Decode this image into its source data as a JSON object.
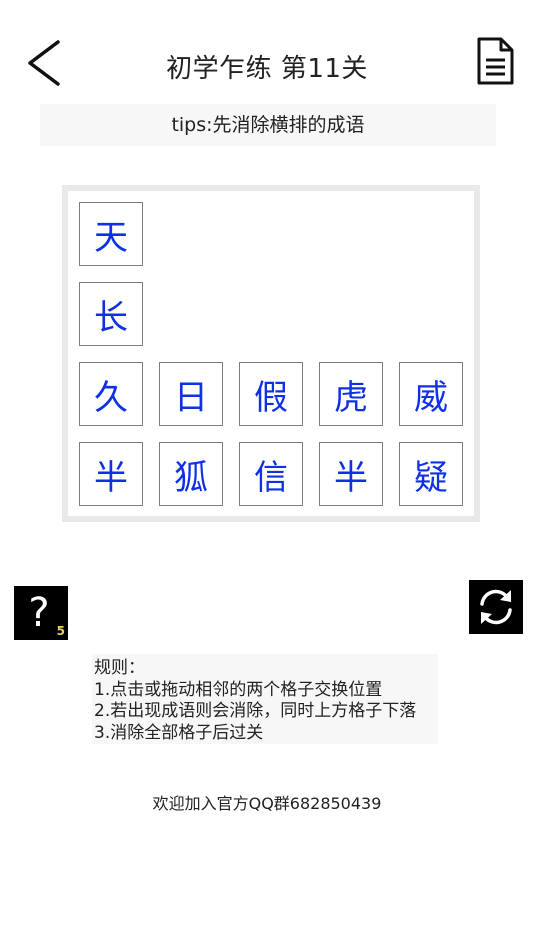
{
  "header": {
    "back_icon": "chevron-left-icon",
    "title": "初学乍练 第11关",
    "doc_icon": "document-icon"
  },
  "tips": "tips:先消除横排的成语",
  "board": {
    "cells": [
      {
        "char": "天",
        "row": 1,
        "col": 1
      },
      {
        "char": "长",
        "row": 2,
        "col": 1
      },
      {
        "char": "久",
        "row": 3,
        "col": 1
      },
      {
        "char": "日",
        "row": 3,
        "col": 2
      },
      {
        "char": "假",
        "row": 3,
        "col": 3
      },
      {
        "char": "虎",
        "row": 3,
        "col": 4
      },
      {
        "char": "威",
        "row": 3,
        "col": 5
      },
      {
        "char": "半",
        "row": 4,
        "col": 1
      },
      {
        "char": "狐",
        "row": 4,
        "col": 2
      },
      {
        "char": "信",
        "row": 4,
        "col": 3
      },
      {
        "char": "半",
        "row": 4,
        "col": 4
      },
      {
        "char": "疑",
        "row": 4,
        "col": 5
      }
    ],
    "char_color": "#1030e6"
  },
  "hint": {
    "label": "?",
    "count": "5"
  },
  "refresh": {
    "icon": "refresh-icon"
  },
  "rules": {
    "heading": "规则：",
    "line1": "1.点击或拖动相邻的两个格子交换位置",
    "line2": "2.若出现成语则会消除，同时上方格子下落",
    "line3": "3.消除全部格子后过关"
  },
  "footer": "欢迎加入官方QQ群682850439"
}
